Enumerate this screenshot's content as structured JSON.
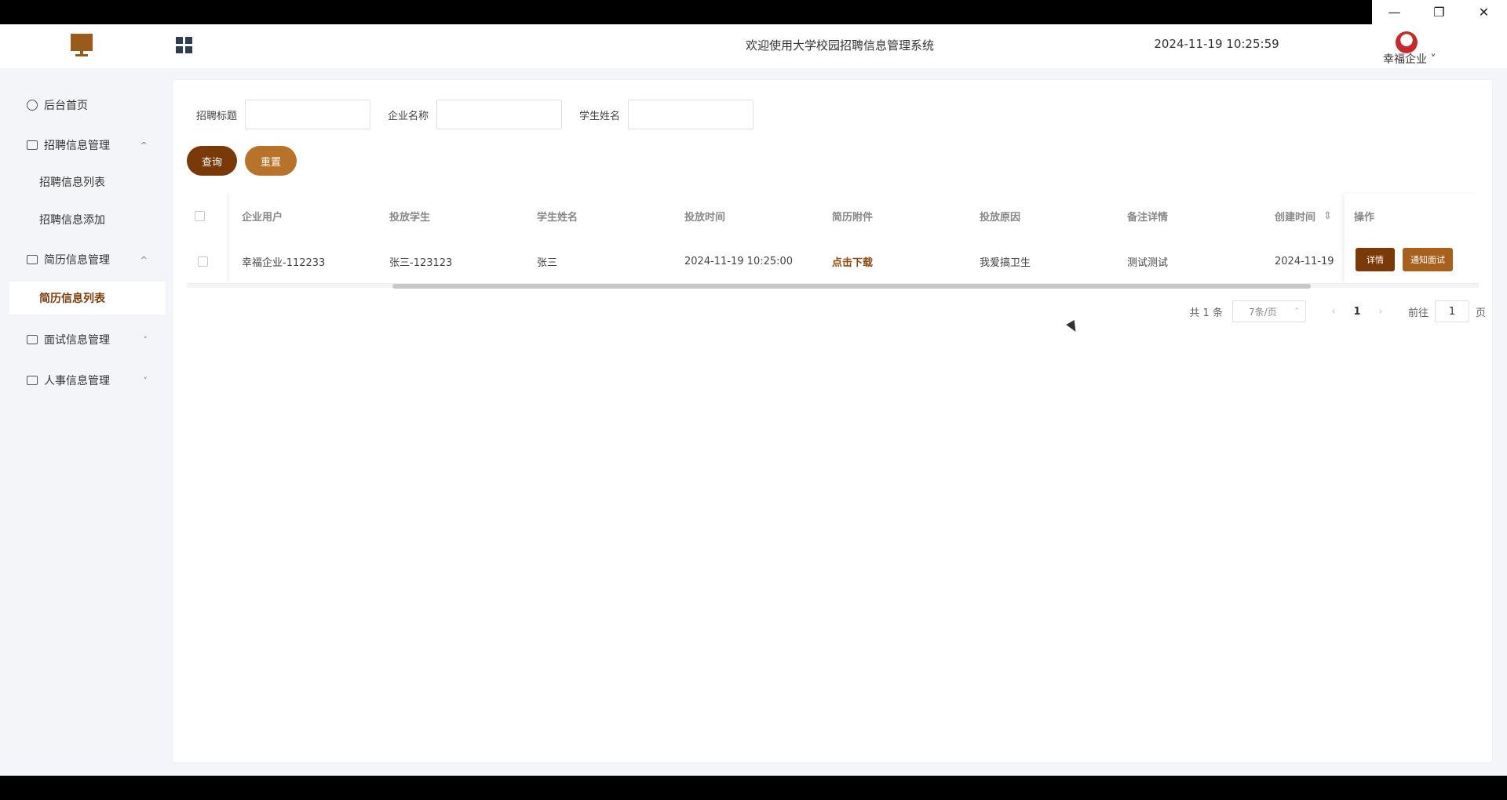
{
  "window": {
    "minimize_icon": "—",
    "restore_icon": "❐",
    "close_icon": "✕"
  },
  "header": {
    "title": "欢迎使用大学校园招聘信息管理系统",
    "datetime": "2024-11-19 10:25:59",
    "user": "幸福企业 ˅"
  },
  "sidebar": {
    "items": [
      {
        "label": "后台首页"
      },
      {
        "label": "招聘信息管理",
        "arrow": "^"
      },
      {
        "label": "招聘信息列表"
      },
      {
        "label": "招聘信息添加"
      },
      {
        "label": "简历信息管理",
        "arrow": "^"
      },
      {
        "label": "简历信息列表"
      },
      {
        "label": "面试信息管理",
        "arrow": "˅"
      },
      {
        "label": "人事信息管理",
        "arrow": "˅"
      }
    ]
  },
  "search": {
    "fields": [
      {
        "label": "招聘标题",
        "value": ""
      },
      {
        "label": "企业名称",
        "value": ""
      },
      {
        "label": "学生姓名",
        "value": ""
      }
    ],
    "query_label": "查询",
    "reset_label": "重置"
  },
  "table": {
    "headers": [
      "企业用户",
      "投放学生",
      "学生姓名",
      "投放时间",
      "简历附件",
      "投放原因",
      "备注详情",
      "创建时间",
      "操作"
    ],
    "sort_icon": "⇕",
    "rows": [
      {
        "company": "幸福企业-112233",
        "student": "张三-123123",
        "name": "张三",
        "time": "2024-11-19 10:25:00",
        "attachment": "点击下载",
        "reason": "我爱搞卫生",
        "remark": "测试测试",
        "created": "2024-11-19",
        "detail_label": "详情",
        "notify_label": "通知面试"
      }
    ]
  },
  "pagination": {
    "total": "共 1 条",
    "page_size": "7条/页",
    "prev": "‹",
    "current": "1",
    "next": "›",
    "goto_label": "前往",
    "goto_value": "1",
    "page_suffix": "页"
  }
}
